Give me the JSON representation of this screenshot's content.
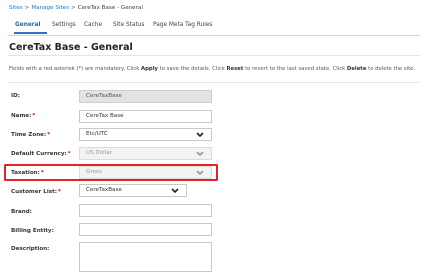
{
  "breadcrumb": {
    "items": [
      "Sites",
      "Manage Sites",
      "CereTax Base - General"
    ],
    "separator": ">"
  },
  "tabs": [
    {
      "label": "General",
      "active": true
    },
    {
      "label": "Settings",
      "active": false
    },
    {
      "label": "Cache",
      "active": false
    },
    {
      "label": "Site Status",
      "active": false
    },
    {
      "label": "Page Meta Tag Rules",
      "active": false
    }
  ],
  "page": {
    "title": "CereTax Base - General"
  },
  "notice": {
    "part1": "Fields with a red asterisk (*) are mandatory. Click ",
    "apply": "Apply",
    "part2": " to save the details. Click ",
    "reset": "Reset",
    "part3": " to revert to the last saved state. Click ",
    "delete": "Delete",
    "part4": " to delete the site."
  },
  "form": {
    "required_mark": "*",
    "id": {
      "label": "ID:",
      "value": "CereTaxBase"
    },
    "name": {
      "label": "Name:",
      "value": "CereTax Base"
    },
    "time_zone": {
      "label": "Time Zone:",
      "value": "Etc/UTC"
    },
    "default_currency": {
      "label": "Default Currency:",
      "value": "US Dollar"
    },
    "taxation": {
      "label": "Taxation:",
      "value": "Gross"
    },
    "customer_list": {
      "label": "Customer List:",
      "value": "CereTaxBase"
    },
    "brand": {
      "label": "Brand:",
      "value": ""
    },
    "billing_entity": {
      "label": "Billing Entity:",
      "value": ""
    },
    "description": {
      "label": "Description:",
      "value": ""
    }
  },
  "colors": {
    "link": "#2b74c7",
    "required": "#d0021b",
    "highlight": "#e0242a"
  }
}
